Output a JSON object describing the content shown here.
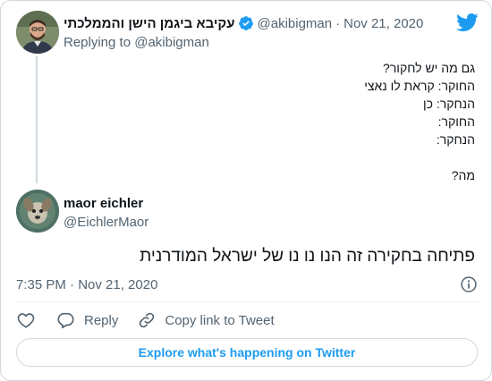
{
  "parent_tweet": {
    "display_name": "עקיבא ביגמן הישן והממלכתי",
    "handle": "@akibigman",
    "separator": "·",
    "date": "Nov 21, 2020",
    "replying_prefix": "Replying to",
    "replying_to": "@akibigman",
    "text_lines": [
      "גם מה יש לחקור?",
      "החוקר: קראת לו נאצי",
      "הנחקר: כן",
      "החוקר:",
      "הנחקר:",
      "",
      "מה?"
    ],
    "avatar_icon": "person-avatar-icon",
    "verified_icon": "verified-badge-icon"
  },
  "main_tweet": {
    "display_name": "maor eichler",
    "handle": "@EichlerMaor",
    "text": "פתיחה בחקירה זה הנו נו נו של ישראל המודרנית",
    "timestamp": "7:35 PM · Nov 21, 2020",
    "avatar_icon": "dog-avatar-icon"
  },
  "actions": {
    "like_icon": "heart-icon",
    "reply_label": "Reply",
    "reply_icon": "reply-bubble-icon",
    "copy_link_label": "Copy link to Tweet",
    "copy_link_icon": "link-icon"
  },
  "explore_button_label": "Explore what's happening on Twitter",
  "colors": {
    "accent": "#1d9bf0",
    "text_primary": "#0f1419",
    "text_secondary": "#536471",
    "border": "#cfd9de"
  }
}
